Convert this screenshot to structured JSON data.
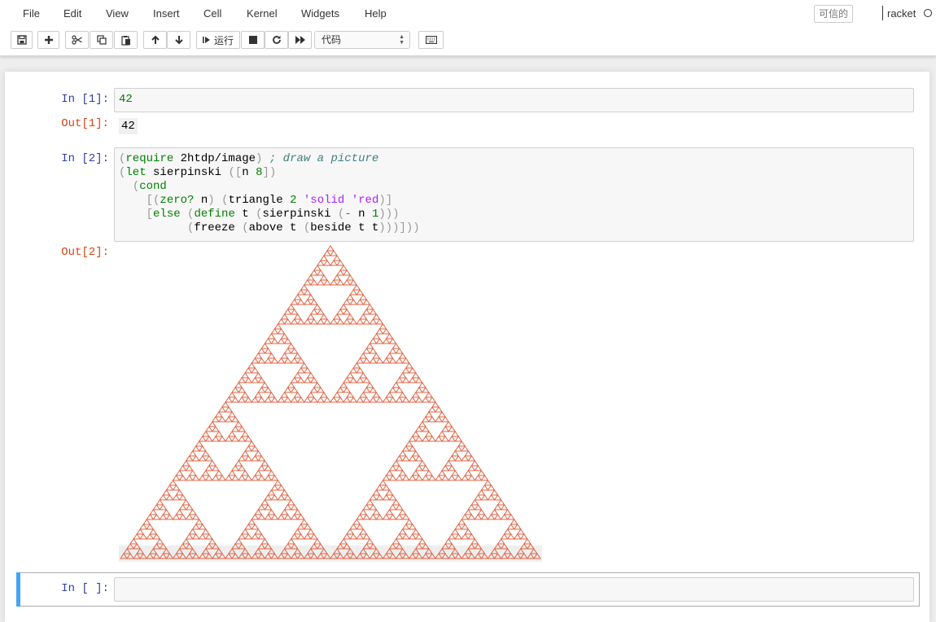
{
  "menu": {
    "items": [
      "File",
      "Edit",
      "View",
      "Insert",
      "Cell",
      "Kernel",
      "Widgets",
      "Help"
    ],
    "trusted_label": "可信的",
    "kernel_name": "racket"
  },
  "toolbar": {
    "run_label": "运行",
    "cell_type": "代码",
    "buttons": [
      "save-icon",
      "plus-icon",
      "cut-icon",
      "copy-icon",
      "paste-icon",
      "arrow-up-icon",
      "arrow-down-icon",
      "run-icon",
      "stop-icon",
      "restart-icon",
      "fast-forward-icon",
      "keyboard-icon"
    ]
  },
  "cells": [
    {
      "in_prompt": "In [1]:",
      "out_prompt": "Out[1]:",
      "source": "42",
      "output_text": "42"
    },
    {
      "in_prompt": "In [2]:",
      "out_prompt": "Out[2]:",
      "source_lines": [
        "(require 2htdp/image) ; draw a picture",
        "(let sierpinski ([n 8])",
        "  (cond",
        "    [(zero? n) (triangle 2 'solid 'red)]",
        "    [else (define t (sierpinski (- n 1)))",
        "          (freeze (above t (beside t t)))]))"
      ],
      "output_image": "sierpinski-triangle",
      "image_color": "#e06040"
    },
    {
      "in_prompt": "In [ ]:",
      "source": ""
    }
  ],
  "colors": {
    "accent_selected": "#42a5f5",
    "in_prompt": "#303f9f",
    "out_prompt": "#d84315"
  }
}
